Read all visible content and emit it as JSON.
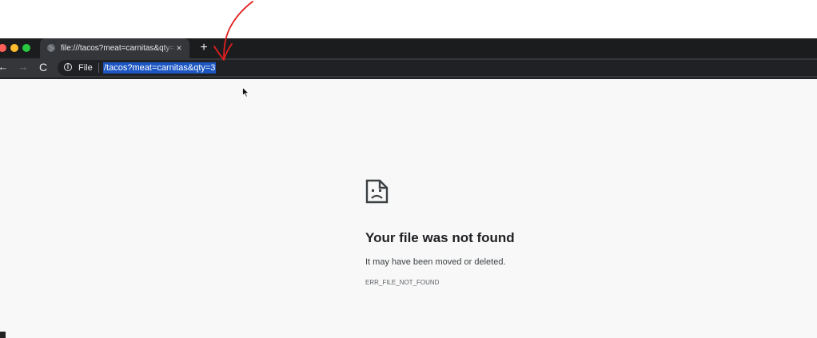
{
  "tab": {
    "title": "file:///tacos?meat=carnitas&qty=3",
    "close_glyph": "×",
    "favicon_icon": "globe-icon"
  },
  "tabstrip": {
    "new_tab_glyph": "+"
  },
  "toolbar": {
    "back_glyph": "←",
    "forward_glyph": "→",
    "reload_glyph": "C",
    "scheme_label": "File",
    "url": "/tacos?meat=carnitas&qty=3",
    "url_selected": true
  },
  "error_page": {
    "icon": "sad-file-icon",
    "title": "Your file was not found",
    "description": "It may have been moved or deleted.",
    "code": "ERR_FILE_NOT_FOUND"
  },
  "colors": {
    "tab_active": "#35363a",
    "tabstrip": "#1b1c1e",
    "url_selection": "#1d56c2",
    "annotation": "#e02020",
    "page_background": "#f8f8f8"
  }
}
